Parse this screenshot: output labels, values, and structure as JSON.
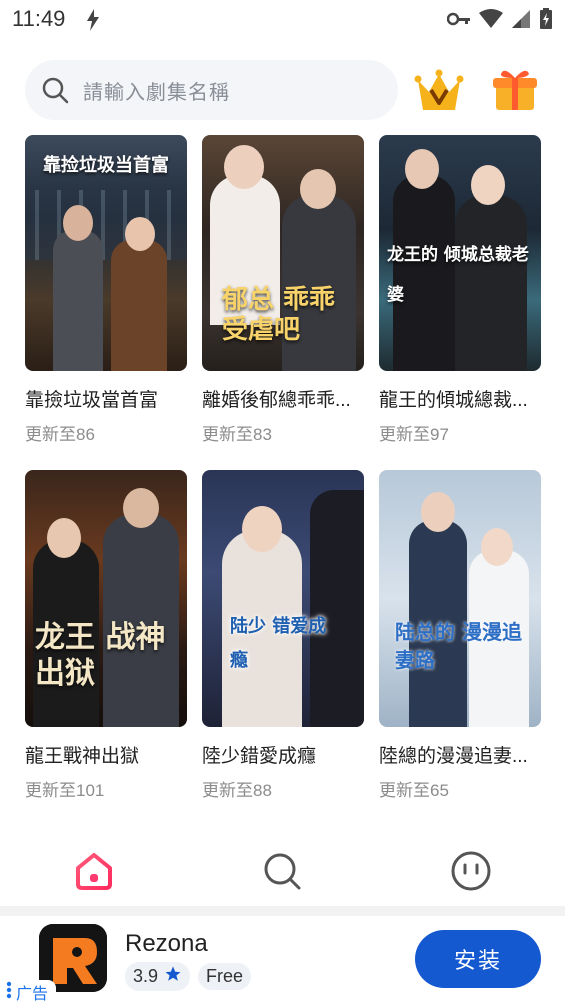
{
  "status": {
    "time": "11:49"
  },
  "search": {
    "placeholder": "請輸入劇集名稱"
  },
  "dramas": [
    {
      "title": "靠撿垃圾當首富",
      "subtitle": "更新至86",
      "poster_text": "靠捡垃圾当首富"
    },
    {
      "title": "離婚後郁總乖乖...",
      "subtitle": "更新至83",
      "poster_text": "郁总 乖乖受虐吧"
    },
    {
      "title": "龍王的傾城總裁...",
      "subtitle": "更新至97",
      "poster_text": "龙王的 倾城总裁老婆"
    },
    {
      "title": "龍王戰神出獄",
      "subtitle": "更新至101",
      "poster_text": "龙王 战神出狱"
    },
    {
      "title": "陸少錯愛成癮",
      "subtitle": "更新至88",
      "poster_text": "陆少 错爱成瘾"
    },
    {
      "title": "陸總的漫漫追妻...",
      "subtitle": "更新至65",
      "poster_text": "陆总的 漫漫追妻路"
    }
  ],
  "ad": {
    "app_name": "Rezona",
    "rating": "3.9",
    "price": "Free",
    "install_label": "安装",
    "tag_label": "广告"
  },
  "colors": {
    "accent_pink": "#ff3a6e",
    "install_blue": "#1559d1",
    "search_bg": "#f3f5f8"
  }
}
